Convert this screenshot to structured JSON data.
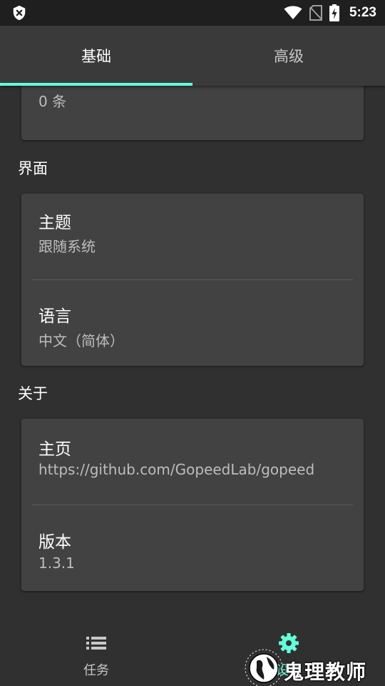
{
  "status_bar": {
    "time": "5:23",
    "icons": [
      "shield-x-icon",
      "wifi-icon",
      "no-sim-icon",
      "battery-charging-icon"
    ]
  },
  "tabs": [
    {
      "label": "基础",
      "selected": true
    },
    {
      "label": "高级",
      "selected": false
    }
  ],
  "previous_card": {
    "value": "0 条"
  },
  "sections": {
    "interface": {
      "header": "界面",
      "items": [
        {
          "title": "主题",
          "subtitle": "跟随系统"
        },
        {
          "title": "语言",
          "subtitle": "中文（简体）"
        }
      ]
    },
    "about": {
      "header": "关于",
      "items": [
        {
          "title": "主页",
          "subtitle": "https://github.com/GopeedLab/gopeed"
        },
        {
          "title": "版本",
          "subtitle": "1.3.1"
        }
      ]
    }
  },
  "bottom_nav": [
    {
      "label": "任务",
      "icon": "list-icon",
      "selected": false
    },
    {
      "label": "设置",
      "icon": "gear-icon",
      "selected": true
    }
  ],
  "watermark": {
    "text": "鬼理教师",
    "icon": "globe-logo-icon"
  },
  "colors": {
    "accent": "#64ffda",
    "background": "#303030",
    "card": "#424242",
    "tab_bar": "#3a3a3a",
    "status_bar": "#1f1f1f"
  }
}
